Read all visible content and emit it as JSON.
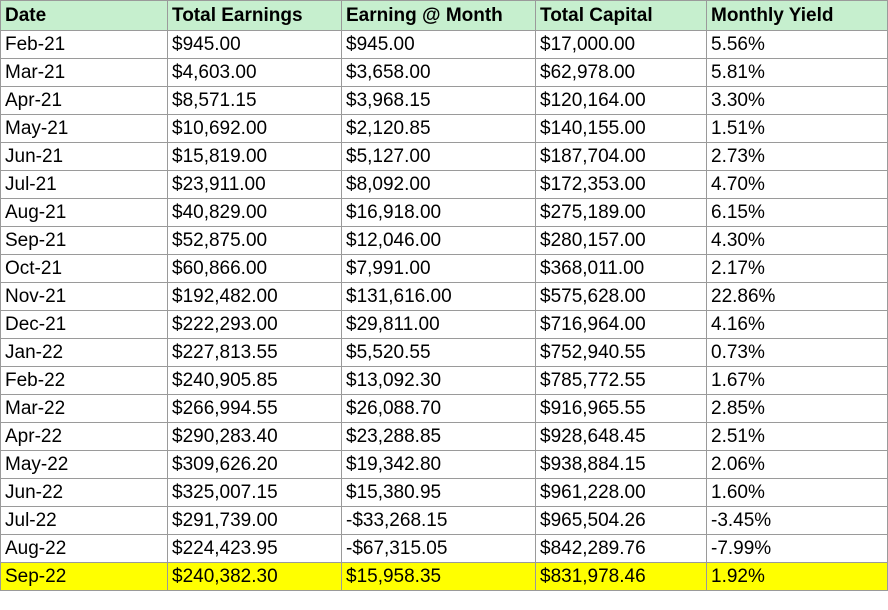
{
  "colors": {
    "header_fill": "#c6efce",
    "highlight_fill": "#ffff00",
    "grid_line": "#9a9a9a"
  },
  "headers": [
    "Date",
    "Total Earnings",
    "Earning @ Month",
    "Total Capital",
    "Monthly Yield"
  ],
  "rows": [
    [
      "Feb-21",
      "$945.00",
      "$945.00",
      "$17,000.00",
      "5.56%"
    ],
    [
      "Mar-21",
      "$4,603.00",
      "$3,658.00",
      "$62,978.00",
      "5.81%"
    ],
    [
      "Apr-21",
      "$8,571.15",
      "$3,968.15",
      "$120,164.00",
      "3.30%"
    ],
    [
      "May-21",
      "$10,692.00",
      "$2,120.85",
      "$140,155.00",
      "1.51%"
    ],
    [
      "Jun-21",
      "$15,819.00",
      "$5,127.00",
      "$187,704.00",
      "2.73%"
    ],
    [
      "Jul-21",
      "$23,911.00",
      "$8,092.00",
      "$172,353.00",
      "4.70%"
    ],
    [
      "Aug-21",
      "$40,829.00",
      "$16,918.00",
      "$275,189.00",
      "6.15%"
    ],
    [
      "Sep-21",
      "$52,875.00",
      "$12,046.00",
      "$280,157.00",
      "4.30%"
    ],
    [
      "Oct-21",
      "$60,866.00",
      "$7,991.00",
      "$368,011.00",
      "2.17%"
    ],
    [
      "Nov-21",
      "$192,482.00",
      "$131,616.00",
      "$575,628.00",
      "22.86%"
    ],
    [
      "Dec-21",
      "$222,293.00",
      "$29,811.00",
      "$716,964.00",
      "4.16%"
    ],
    [
      "Jan-22",
      "$227,813.55",
      "$5,520.55",
      "$752,940.55",
      "0.73%"
    ],
    [
      "Feb-22",
      "$240,905.85",
      "$13,092.30",
      "$785,772.55",
      "1.67%"
    ],
    [
      "Mar-22",
      "$266,994.55",
      "$26,088.70",
      "$916,965.55",
      "2.85%"
    ],
    [
      "Apr-22",
      "$290,283.40",
      "$23,288.85",
      "$928,648.45",
      "2.51%"
    ],
    [
      "May-22",
      "$309,626.20",
      "$19,342.80",
      "$938,884.15",
      "2.06%"
    ],
    [
      "Jun-22",
      "$325,007.15",
      "$15,380.95",
      "$961,228.00",
      "1.60%"
    ],
    [
      "Jul-22",
      "$291,739.00",
      "-$33,268.15",
      "$965,504.26",
      "-3.45%"
    ],
    [
      "Aug-22",
      "$224,423.95",
      "-$67,315.05",
      "$842,289.76",
      "-7.99%"
    ],
    [
      "Sep-22",
      "$240,382.30",
      "$15,958.35",
      "$831,978.46",
      "1.92%"
    ]
  ],
  "highlighted_row_index": 19
}
